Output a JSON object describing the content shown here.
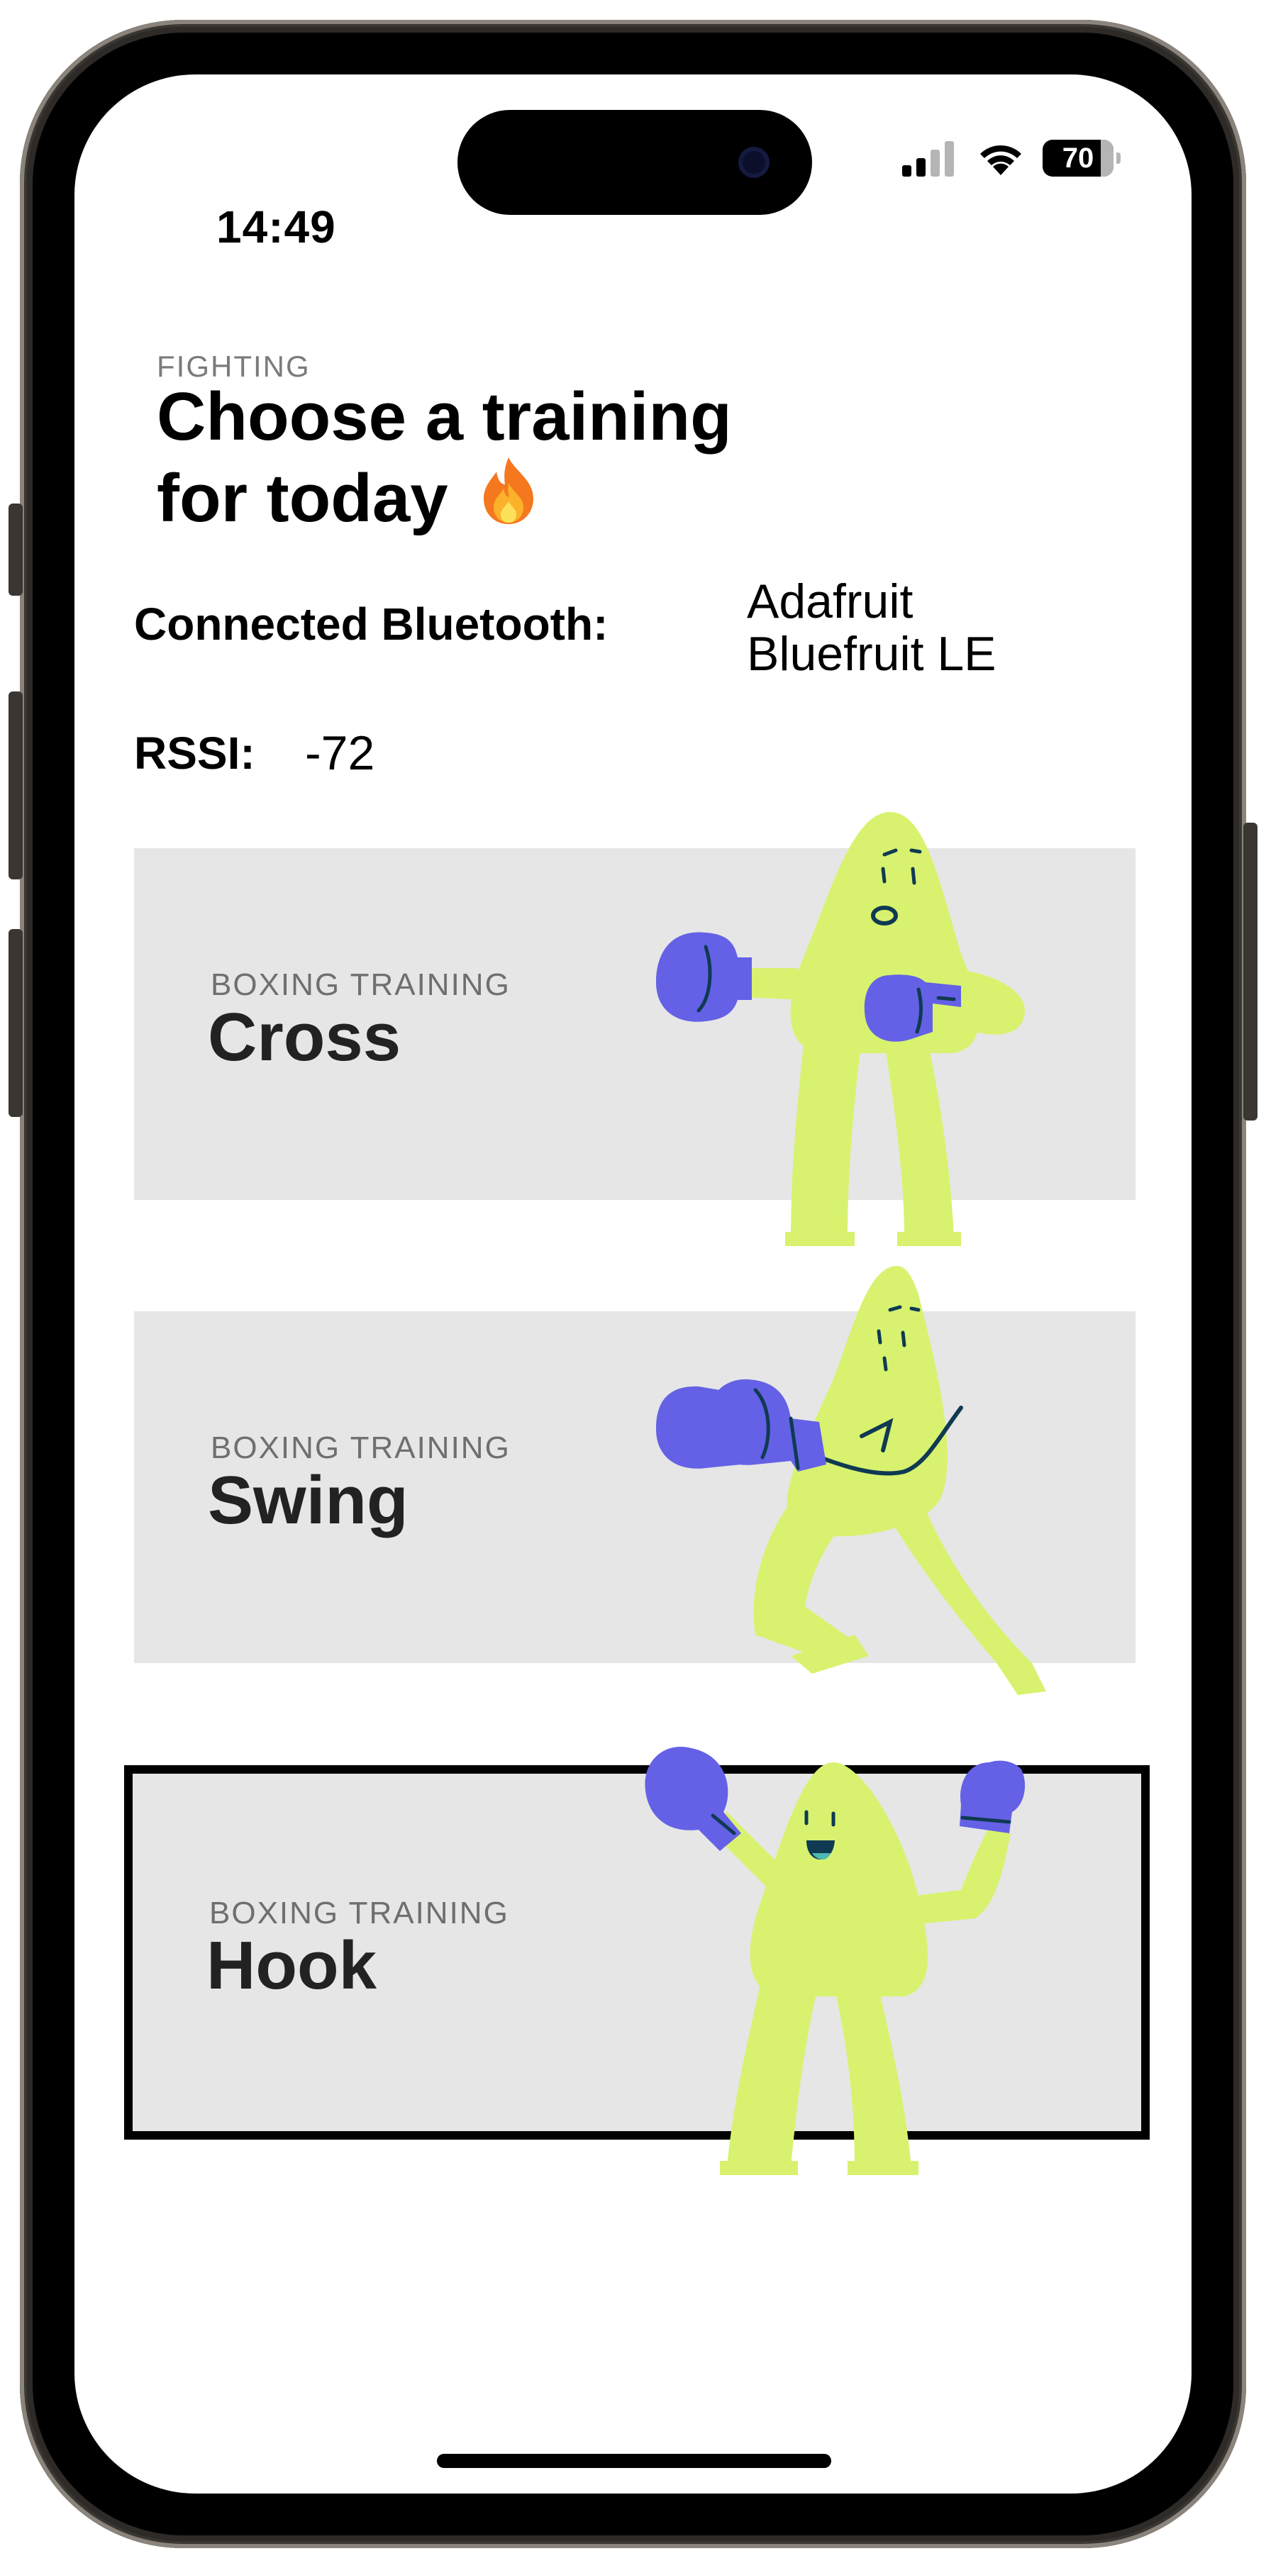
{
  "status_bar": {
    "time": "14:49",
    "battery": "70",
    "icons": [
      "signal-icon",
      "wifi-icon",
      "battery-icon"
    ]
  },
  "header": {
    "eyebrow": "FIGHTING",
    "title_line1": "Choose a training",
    "title_line2": "for today",
    "title_emoji": "🔥"
  },
  "bluetooth": {
    "label": "Connected Bluetooth:",
    "value_line1": "Adafruit",
    "value_line2": "Bluefruit LE"
  },
  "rssi": {
    "label": "RSSI:",
    "value": "-72"
  },
  "trainings": [
    {
      "subtitle": "BOXING TRAINING",
      "name": "Cross"
    },
    {
      "subtitle": "BOXING TRAINING",
      "name": "Swing"
    },
    {
      "subtitle": "BOXING TRAINING",
      "name": "Hook"
    }
  ],
  "colors": {
    "figure": "#d8f26f",
    "glove": "#6461e6",
    "outline": "#0f3a52",
    "card": "#e6e6e6"
  }
}
